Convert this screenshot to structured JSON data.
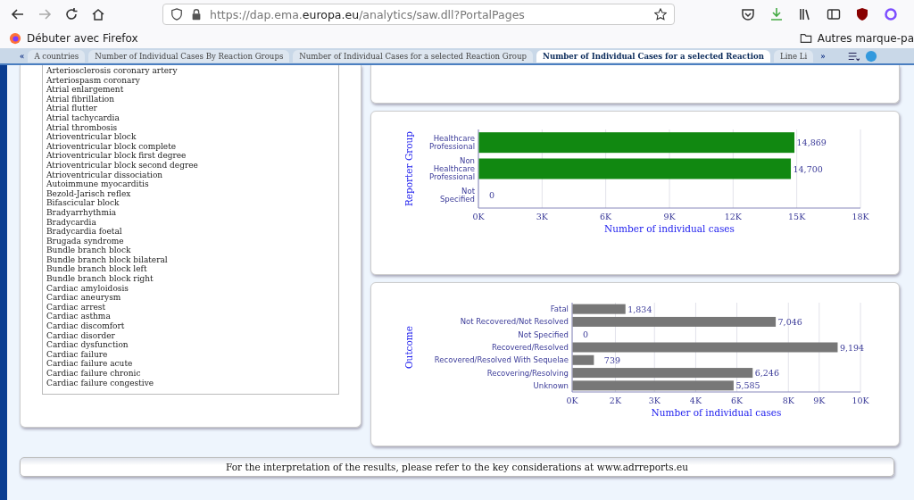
{
  "browser": {
    "url": "https://dap.ema.**europa.eu**/analytics/saw.dll?PortalPages",
    "bookmarks": [
      {
        "label": "Débuter avec Firefox",
        "kind": "firefox"
      },
      {
        "label": "Autres marque-pa",
        "kind": "folder"
      }
    ]
  },
  "tabs": [
    {
      "label": "A countries",
      "selected": false
    },
    {
      "label": "Number of Individual Cases By Reaction Groups",
      "selected": false
    },
    {
      "label": "Number of Individual Cases for a selected Reaction Group",
      "selected": false
    },
    {
      "label": "Number of Individual Cases for a selected Reaction",
      "selected": true
    },
    {
      "label": "Line Li",
      "selected": false
    }
  ],
  "tab_scroll": {
    "left": "«",
    "right": "»"
  },
  "reaction_list": [
    "Arteriosclerosis coronary artery",
    "Arteriospasm coronary",
    "Atrial enlargement",
    "Atrial fibrillation",
    "Atrial flutter",
    "Atrial tachycardia",
    "Atrial thrombosis",
    "Atrioventricular block",
    "Atrioventricular block complete",
    "Atrioventricular block first degree",
    "Atrioventricular block second degree",
    "Atrioventricular dissociation",
    "Autoimmune myocarditis",
    "Bezold-Jarisch reflex",
    "Bifascicular block",
    "Bradyarrhythmia",
    "Bradycardia",
    "Bradycardia foetal",
    "Brugada syndrome",
    "Bundle branch block",
    "Bundle branch block bilateral",
    "Bundle branch block left",
    "Bundle branch block right",
    "Cardiac amyloidosis",
    "Cardiac aneurysm",
    "Cardiac arrest",
    "Cardiac asthma",
    "Cardiac discomfort",
    "Cardiac disorder",
    "Cardiac dysfunction",
    "Cardiac failure",
    "Cardiac failure acute",
    "Cardiac failure chronic",
    "Cardiac failure congestive"
  ],
  "charts": [
    {
      "chart_data": {
        "type": "bar",
        "orientation": "horizontal",
        "xlabel": "Number of individual cases",
        "ylabel": "Reporter Group",
        "categories": [
          "Healthcare Professional",
          "Non Healthcare Professional",
          "Not Specified"
        ],
        "grid": true,
        "series": [
          {
            "color": "#118811",
            "values": [
              14869,
              14700,
              0
            ]
          }
        ],
        "value_labels": [
          "14,869",
          "14,700",
          "0"
        ],
        "xlim": [
          0,
          18000
        ],
        "xticks": [
          {
            "value": 0,
            "label": "0K"
          },
          {
            "value": 3000,
            "label": "3K"
          },
          {
            "value": 6000,
            "label": "6K"
          },
          {
            "value": 9000,
            "label": "9K"
          },
          {
            "value": 12000,
            "label": "12K"
          },
          {
            "value": 15000,
            "label": "15K"
          },
          {
            "value": 18000,
            "label": "18K"
          }
        ]
      }
    },
    {
      "chart_data": {
        "type": "bar",
        "orientation": "horizontal",
        "xlabel": "Number of individual cases",
        "ylabel": "Outcome",
        "categories": [
          "Fatal",
          "Not Recovered/Not Resolved",
          "Not Specified",
          "Recovered/Resolved",
          "Recovered/Resolved With Sequelae",
          "Recovering/Resolving",
          "Unknown"
        ],
        "grid": true,
        "series": [
          {
            "color": "#777777",
            "values": [
              1834,
              7046,
              0,
              9194,
              739,
              6246,
              5585
            ]
          }
        ],
        "value_labels": [
          "1,834",
          "7,046",
          "0",
          "9,194",
          "739",
          "6,246",
          "5,585"
        ],
        "xlim": [
          0,
          10000
        ],
        "xticks": [
          {
            "value": 0,
            "label": "0K"
          },
          {
            "value": 1500,
            "label": "2K"
          },
          {
            "value": 2857,
            "label": "3K"
          },
          {
            "value": 4286,
            "label": "4K"
          },
          {
            "value": 5714,
            "label": "6K"
          },
          {
            "value": 7500,
            "label": "8K"
          },
          {
            "value": 8571,
            "label": "9K"
          },
          {
            "value": 10000,
            "label": "10K"
          }
        ]
      }
    }
  ],
  "footer": "For the interpretation of the results, please refer to the key considerations at www.adrreports.eu"
}
